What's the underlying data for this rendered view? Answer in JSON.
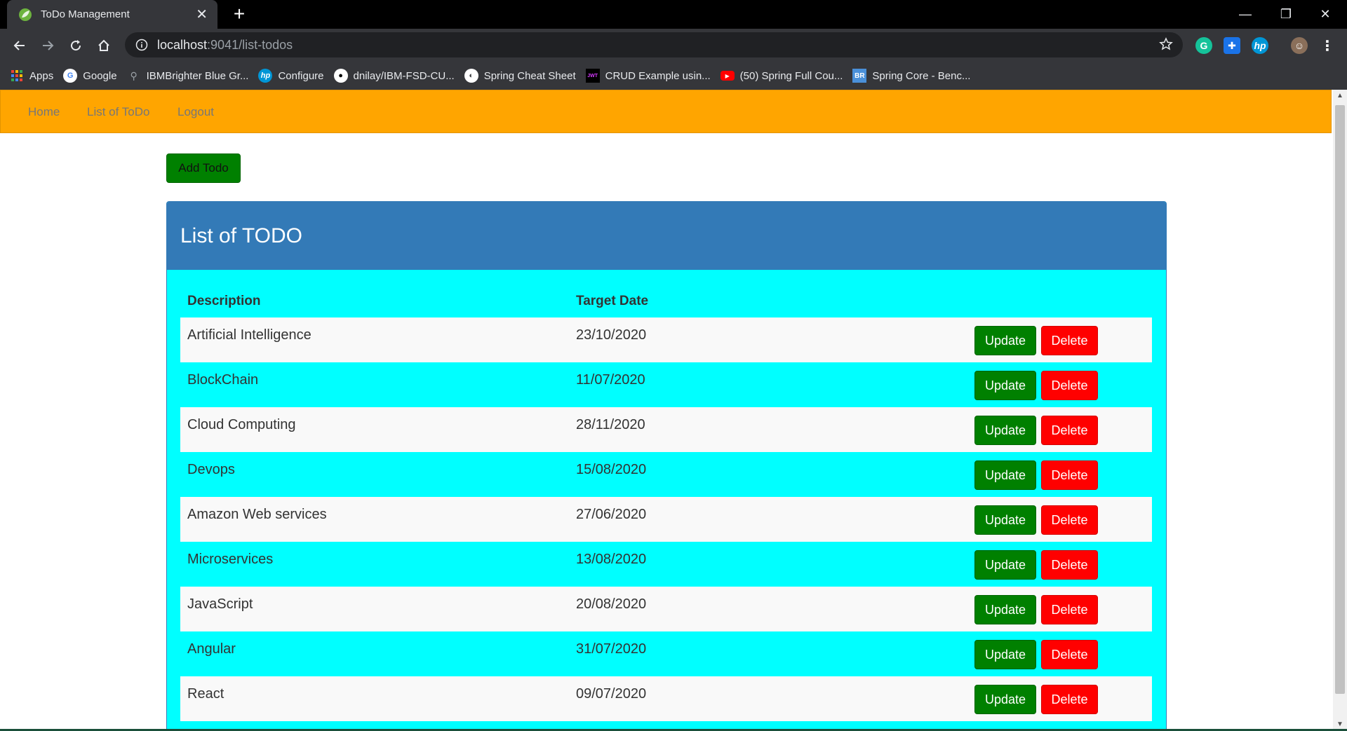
{
  "browser": {
    "tab_title": "ToDo Management",
    "url_host": "localhost",
    "url_path": ":9041/list-todos",
    "bookmarks": [
      {
        "label": "Apps",
        "icon": "apps-grid-icon",
        "color": "#ea4335"
      },
      {
        "label": "Google",
        "icon": "google-icon",
        "color": "#ffffff"
      },
      {
        "label": "IBMBrighter Blue Gr...",
        "icon": "bike-icon",
        "color": "#9aa0a6"
      },
      {
        "label": "Configure",
        "icon": "hp-icon",
        "color": "#0096d6"
      },
      {
        "label": "dnilay/IBM-FSD-CU...",
        "icon": "github-icon",
        "color": "#ffffff"
      },
      {
        "label": "Spring Cheat Sheet",
        "icon": "globe-icon",
        "color": "#ffffff"
      },
      {
        "label": "CRUD Example usin...",
        "icon": "jwt-icon",
        "color": "#d63aff"
      },
      {
        "label": "(50) Spring Full Cou...",
        "icon": "youtube-icon",
        "color": "#ff0000"
      },
      {
        "label": "Spring Core - Benc...",
        "icon": "br-icon",
        "color": "#4a90d9"
      }
    ]
  },
  "navbar": {
    "home": "Home",
    "list": "List of ToDo",
    "logout": "Logout"
  },
  "main": {
    "add_button": "Add Todo",
    "panel_title": "List of TODO",
    "columns": [
      "Description",
      "Target Date"
    ],
    "update_label": "Update",
    "delete_label": "Delete",
    "todos": [
      {
        "description": "Artificial Intelligence",
        "date": "23/10/2020"
      },
      {
        "description": "BlockChain",
        "date": "11/07/2020"
      },
      {
        "description": "Cloud Computing",
        "date": "28/11/2020"
      },
      {
        "description": "Devops",
        "date": "15/08/2020"
      },
      {
        "description": "Amazon Web services",
        "date": "27/06/2020"
      },
      {
        "description": "Microservices",
        "date": "13/08/2020"
      },
      {
        "description": "JavaScript",
        "date": "20/08/2020"
      },
      {
        "description": "Angular",
        "date": "31/07/2020"
      },
      {
        "description": "React",
        "date": "09/07/2020"
      }
    ]
  },
  "colors": {
    "navbar": "#ffa500",
    "panel_heading": "#337ab7",
    "panel_body": "#00ffff",
    "update": "#008000",
    "delete": "#ff0000"
  }
}
